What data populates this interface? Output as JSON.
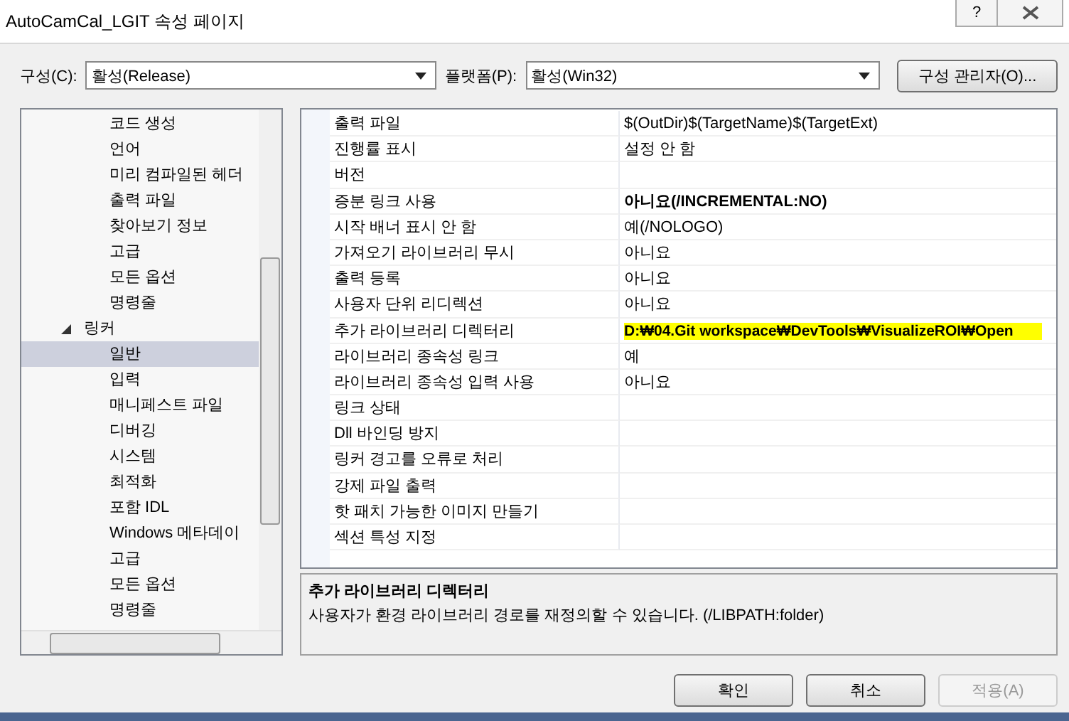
{
  "window": {
    "title": "AutoCamCal_LGIT 속성 페이지",
    "help_glyph": "?"
  },
  "toolbar": {
    "config_label": "구성(C):",
    "config_value": "활성(Release)",
    "platform_label": "플랫폼(P):",
    "platform_value": "활성(Win32)",
    "manager_button": "구성 관리자(O)..."
  },
  "tree": {
    "scrolled_group_children": [
      {
        "label": "코드 생성",
        "selected": false
      },
      {
        "label": "언어",
        "selected": false
      },
      {
        "label": "미리 컴파일된 헤더",
        "selected": false
      },
      {
        "label": "출력 파일",
        "selected": false
      },
      {
        "label": "찾아보기 정보",
        "selected": false
      },
      {
        "label": "고급",
        "selected": false
      },
      {
        "label": "모든 옵션",
        "selected": false
      },
      {
        "label": "명령줄",
        "selected": false
      }
    ],
    "groups": [
      {
        "label": "링커",
        "expanded": true,
        "children": [
          {
            "label": "일반",
            "selected": true
          },
          {
            "label": "입력",
            "selected": false
          },
          {
            "label": "매니페스트 파일",
            "selected": false
          },
          {
            "label": "디버깅",
            "selected": false
          },
          {
            "label": "시스템",
            "selected": false
          },
          {
            "label": "최적화",
            "selected": false
          },
          {
            "label": "포함 IDL",
            "selected": false
          },
          {
            "label": "Windows 메타데이",
            "selected": false
          },
          {
            "label": "고급",
            "selected": false
          },
          {
            "label": "모든 옵션",
            "selected": false
          },
          {
            "label": "명령줄",
            "selected": false
          }
        ]
      }
    ]
  },
  "properties": [
    {
      "name": "출력 파일",
      "value": "$(OutDir)$(TargetName)$(TargetExt)",
      "bold": false,
      "highlighted": false
    },
    {
      "name": "진행률 표시",
      "value": "설정 안 함",
      "bold": false,
      "highlighted": false
    },
    {
      "name": "버전"
    },
    {
      "name": "증분 링크 사용",
      "value": "아니요(/INCREMENTAL:NO)",
      "bold": true,
      "highlighted": false
    },
    {
      "name": "시작 배너 표시 안 함",
      "value": "예(/NOLOGO)",
      "bold": false,
      "highlighted": false
    },
    {
      "name": "가져오기 라이브러리 무시",
      "value": "아니요",
      "bold": false,
      "highlighted": false
    },
    {
      "name": "출력 등록",
      "value": "아니요",
      "bold": false,
      "highlighted": false
    },
    {
      "name": "사용자 단위 리디렉션",
      "value": "아니요",
      "bold": false,
      "highlighted": false
    },
    {
      "name": "추가 라이브러리 디렉터리",
      "value": "D:₩04.Git workspace₩DevTools₩VisualizeROI₩Open",
      "bold": true,
      "highlighted": true
    },
    {
      "name": "라이브러리 종속성 링크",
      "value": "예",
      "bold": false,
      "highlighted": false
    },
    {
      "name": "라이브러리 종속성 입력 사용",
      "value": "아니요",
      "bold": false,
      "highlighted": false
    },
    {
      "name": "링크 상태"
    },
    {
      "name": "Dll 바인딩 방지"
    },
    {
      "name": "링커 경고를 오류로 처리"
    },
    {
      "name": "강제 파일 출력"
    },
    {
      "name": "핫 패치 가능한 이미지 만들기"
    },
    {
      "name": "섹션 특성 지정"
    }
  ],
  "description": {
    "title": "추가 라이브러리 디렉터리",
    "text": "사용자가 환경 라이브러리 경로를 재정의할 수 있습니다. (/LIBPATH:folder)"
  },
  "buttons": [
    {
      "label": "확인",
      "disabled": false
    },
    {
      "label": "취소",
      "disabled": false
    },
    {
      "label": "적용(A)",
      "disabled": true
    }
  ]
}
